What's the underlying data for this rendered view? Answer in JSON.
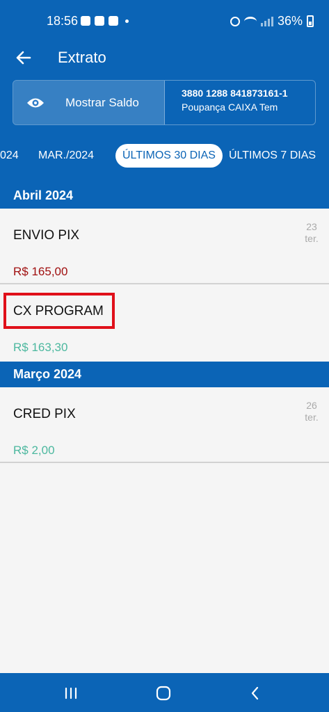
{
  "status_bar": {
    "time": "18:56",
    "battery": "36%"
  },
  "header": {
    "title": "Extrato",
    "show_balance_label": "Mostrar Saldo",
    "account_number": "3880 1288 841873161-1",
    "account_type": "Poupança CAIXA Tem"
  },
  "tabs": [
    {
      "label": "024"
    },
    {
      "label": "MAR./2024"
    },
    {
      "label": "ÚLTIMOS 30 DIAS",
      "active": true
    },
    {
      "label": "ÚLTIMOS 7 DIAS"
    }
  ],
  "sections": [
    {
      "month": "Abril 2024",
      "transactions": [
        {
          "title": "ENVIO PIX",
          "amount": "R$ 165,00",
          "day": "23",
          "weekday": "ter."
        },
        {
          "title": "CX PROGRAM",
          "amount": "R$ 163,30"
        }
      ]
    },
    {
      "month": "Março 2024",
      "transactions": [
        {
          "title": "CRED PIX",
          "amount": "R$ 2,00",
          "day": "26",
          "weekday": "ter."
        }
      ]
    }
  ],
  "colors": {
    "primary": "#0b64b6",
    "debit": "#a01010",
    "credit": "#4cb89f",
    "highlight": "#e0101a"
  }
}
